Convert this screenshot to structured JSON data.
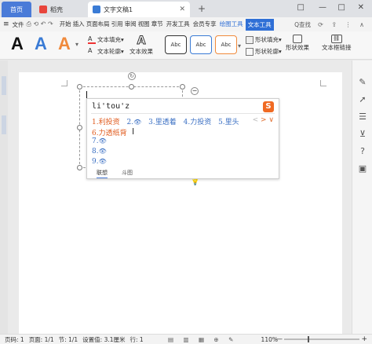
{
  "titlebar": {
    "tabs": [
      {
        "label": "首页"
      },
      {
        "label": "稻壳"
      },
      {
        "label": "文字文稿1"
      }
    ],
    "add_tab": "+",
    "window_controls": [
      "□",
      "—",
      "□",
      "✕"
    ]
  },
  "menubar": {
    "hamburger": "≡",
    "file": "文件",
    "quick_access": "⎙ ⟲ ↶ ↷",
    "tabs": [
      "开始",
      "插入",
      "页面布局",
      "引用",
      "审阅",
      "视图",
      "章节",
      "开发工具",
      "会员专享"
    ],
    "blue_tab": "绘图工具",
    "active_tab": "文本工具",
    "search": "Q查找",
    "right_icons": "⟳ ⇪ ⋮ ∧"
  },
  "ribbon": {
    "bigA_letters": [
      "A",
      "A",
      "A"
    ],
    "bigA_colors": [
      "#111111",
      "#3a7bd5",
      "#f08a3c"
    ],
    "text_fill": "文本填充",
    "text_outline": "文本轮廓",
    "text_effect": "文本效果",
    "shape_styles": [
      "Abc",
      "Abc",
      "Abc"
    ],
    "shape_style_colors": [
      "#333333",
      "#3a7bd5",
      "#f08a3c"
    ],
    "shape_fill": "形状填充",
    "shape_outline": "形状轮廓",
    "shape_effect": "形状效果",
    "textbox_link": "文本框链接"
  },
  "ime": {
    "pinyin": "li'tou'z",
    "logo": "S",
    "candidates": [
      {
        "num": "1.",
        "text": "利投资"
      },
      {
        "num": "2.",
        "text": "👁"
      },
      {
        "num": "3.",
        "text": "里透着"
      },
      {
        "num": "4.",
        "text": "力投资"
      },
      {
        "num": "5.",
        "text": "里头"
      }
    ],
    "nav": [
      "<",
      ">",
      "∨"
    ],
    "rows": [
      {
        "num": "6.",
        "text": "力透纸背"
      },
      {
        "num": "7.",
        "text": "👁"
      },
      {
        "num": "8.",
        "text": "👁"
      },
      {
        "num": "9.",
        "text": "👁"
      }
    ],
    "tabs": [
      "联想",
      "斗图"
    ]
  },
  "statusbar": {
    "page_num": "页码: 1",
    "pages": "页面: 1/1",
    "section": "节: 1/1",
    "setting": "设置值: 3.1厘米",
    "row": "行: 1",
    "zoom": "110%",
    "minus": "—",
    "plus": "+",
    "view_icons": "▤ ▥ ▦ ⊕ ✎"
  },
  "colors": {
    "accent": "#2f6fd6",
    "candidate_highlight": "#e05a1c",
    "sogou_logo": "#f06a23"
  }
}
